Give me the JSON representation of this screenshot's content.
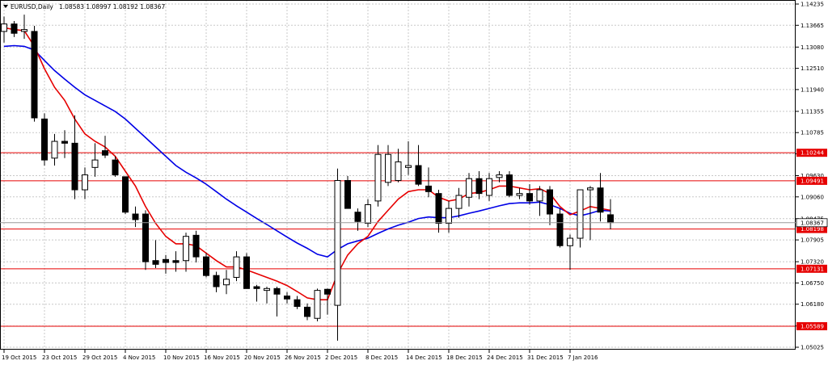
{
  "header": {
    "symbol_label": "EURUSD,Daily",
    "ohlc_label": "1.08583 1.08997 1.08192 1.08367"
  },
  "colors": {
    "background": "#ffffff",
    "grid": "#c8c8c8",
    "candle": "#000000",
    "ma_fast": "#e60000",
    "ma_slow": "#0000e6",
    "level_line": "#e60000",
    "level_box_bg": "#e60000",
    "level_box_text": "#ffffff"
  },
  "chart_data": {
    "type": "candlestick",
    "instrument": "EURUSD",
    "timeframe": "Daily",
    "ylim": [
      1.05025,
      1.14235
    ],
    "y_ticks": [
      "1.14235",
      "1.13665",
      "1.13080",
      "1.12510",
      "1.11940",
      "1.11355",
      "1.10785",
      "1.10215",
      "1.09630",
      "1.09060",
      "1.08475",
      "1.07905",
      "1.07320",
      "1.06750",
      "1.06180",
      "1.05595",
      "1.05025"
    ],
    "x_tick_labels": [
      "19 Oct 2015",
      "23 Oct 2015",
      "29 Oct 2015",
      "4 Nov 2015",
      "10 Nov 2015",
      "16 Nov 2015",
      "20 Nov 2015",
      "26 Nov 2015",
      "2 Dec 2015",
      "8 Dec 2015",
      "14 Dec 2015",
      "18 Dec 2015",
      "24 Dec 2015",
      "31 Dec 2015",
      "7 Jan 2016"
    ],
    "x_tick_bar_index": [
      0,
      4,
      8,
      12,
      16,
      20,
      24,
      28,
      32,
      36,
      40,
      44,
      48,
      52,
      56
    ],
    "grid": true,
    "candles": [
      {
        "o": 1.135,
        "h": 1.139,
        "l": 1.132,
        "c": 1.137
      },
      {
        "o": 1.137,
        "h": 1.1378,
        "l": 1.1335,
        "c": 1.1345
      },
      {
        "o": 1.135,
        "h": 1.1395,
        "l": 1.133,
        "c": 1.1355
      },
      {
        "o": 1.135,
        "h": 1.1365,
        "l": 1.1108,
        "c": 1.1118
      },
      {
        "o": 1.1115,
        "h": 1.113,
        "l": 1.099,
        "c": 1.1005
      },
      {
        "o": 1.101,
        "h": 1.1075,
        "l": 1.099,
        "c": 1.1055
      },
      {
        "o": 1.1055,
        "h": 1.1085,
        "l": 1.101,
        "c": 1.105
      },
      {
        "o": 1.105,
        "h": 1.1125,
        "l": 1.09,
        "c": 1.0925
      },
      {
        "o": 1.0925,
        "h": 1.0985,
        "l": 1.09,
        "c": 1.0965
      },
      {
        "o": 1.0985,
        "h": 1.105,
        "l": 1.096,
        "c": 1.1005
      },
      {
        "o": 1.103,
        "h": 1.107,
        "l": 1.101,
        "c": 1.1018
      },
      {
        "o": 1.1005,
        "h": 1.1015,
        "l": 1.096,
        "c": 1.0965
      },
      {
        "o": 1.096,
        "h": 1.096,
        "l": 1.086,
        "c": 1.0865
      },
      {
        "o": 1.086,
        "h": 1.088,
        "l": 1.0825,
        "c": 1.0845
      },
      {
        "o": 1.086,
        "h": 1.087,
        "l": 1.071,
        "c": 1.0732
      },
      {
        "o": 1.0735,
        "h": 1.079,
        "l": 1.0715,
        "c": 1.0725
      },
      {
        "o": 1.0738,
        "h": 1.075,
        "l": 1.07,
        "c": 1.073
      },
      {
        "o": 1.0735,
        "h": 1.076,
        "l": 1.0705,
        "c": 1.073
      },
      {
        "o": 1.0735,
        "h": 1.081,
        "l": 1.0705,
        "c": 1.08
      },
      {
        "o": 1.0803,
        "h": 1.0815,
        "l": 1.073,
        "c": 1.0745
      },
      {
        "o": 1.0745,
        "h": 1.0755,
        "l": 1.069,
        "c": 1.0695
      },
      {
        "o": 1.0695,
        "h": 1.0705,
        "l": 1.065,
        "c": 1.0665
      },
      {
        "o": 1.067,
        "h": 1.071,
        "l": 1.0645,
        "c": 1.0685
      },
      {
        "o": 1.069,
        "h": 1.076,
        "l": 1.068,
        "c": 1.0745
      },
      {
        "o": 1.0745,
        "h": 1.0755,
        "l": 1.066,
        "c": 1.066
      },
      {
        "o": 1.0665,
        "h": 1.067,
        "l": 1.0625,
        "c": 1.066
      },
      {
        "o": 1.0655,
        "h": 1.0665,
        "l": 1.062,
        "c": 1.066
      },
      {
        "o": 1.066,
        "h": 1.0665,
        "l": 1.0585,
        "c": 1.0645
      },
      {
        "o": 1.064,
        "h": 1.065,
        "l": 1.062,
        "c": 1.0632
      },
      {
        "o": 1.063,
        "h": 1.064,
        "l": 1.0605,
        "c": 1.0612
      },
      {
        "o": 1.061,
        "h": 1.062,
        "l": 1.0575,
        "c": 1.0585
      },
      {
        "o": 1.058,
        "h": 1.066,
        "l": 1.0572,
        "c": 1.0655
      },
      {
        "o": 1.0658,
        "h": 1.066,
        "l": 1.059,
        "c": 1.0645
      },
      {
        "o": 1.0615,
        "h": 1.0982,
        "l": 1.052,
        "c": 1.095
      },
      {
        "o": 1.095,
        "h": 1.0962,
        "l": 1.0875,
        "c": 1.0875
      },
      {
        "o": 1.0865,
        "h": 1.0875,
        "l": 1.0815,
        "c": 1.084
      },
      {
        "o": 1.0835,
        "h": 1.09,
        "l": 1.0825,
        "c": 1.0885
      },
      {
        "o": 1.0895,
        "h": 1.1045,
        "l": 1.088,
        "c": 1.102
      },
      {
        "o": 1.0945,
        "h": 1.1045,
        "l": 1.0935,
        "c": 1.102
      },
      {
        "o": 1.095,
        "h": 1.1035,
        "l": 1.0945,
        "c": 1.1
      },
      {
        "o": 1.0985,
        "h": 1.1055,
        "l": 1.0965,
        "c": 1.099
      },
      {
        "o": 1.099,
        "h": 1.1045,
        "l": 1.0935,
        "c": 1.094
      },
      {
        "o": 1.0935,
        "h": 1.0985,
        "l": 1.0905,
        "c": 1.092
      },
      {
        "o": 1.0915,
        "h": 1.0925,
        "l": 1.081,
        "c": 1.0835
      },
      {
        "o": 1.0835,
        "h": 1.0895,
        "l": 1.081,
        "c": 1.0875
      },
      {
        "o": 1.0875,
        "h": 1.093,
        "l": 1.085,
        "c": 1.091
      },
      {
        "o": 1.0905,
        "h": 1.097,
        "l": 1.088,
        "c": 1.0955
      },
      {
        "o": 1.0955,
        "h": 1.0975,
        "l": 1.09,
        "c": 1.0915
      },
      {
        "o": 1.091,
        "h": 1.097,
        "l": 1.0895,
        "c": 1.0955
      },
      {
        "o": 1.0958,
        "h": 1.0975,
        "l": 1.0945,
        "c": 1.0965
      },
      {
        "o": 1.0965,
        "h": 1.0975,
        "l": 1.0905,
        "c": 1.091
      },
      {
        "o": 1.091,
        "h": 1.093,
        "l": 1.09,
        "c": 1.0915
      },
      {
        "o": 1.0915,
        "h": 1.094,
        "l": 1.0885,
        "c": 1.0895
      },
      {
        "o": 1.0895,
        "h": 1.0935,
        "l": 1.0855,
        "c": 1.0925
      },
      {
        "o": 1.0925,
        "h": 1.0935,
        "l": 1.083,
        "c": 1.086
      },
      {
        "o": 1.086,
        "h": 1.0875,
        "l": 1.077,
        "c": 1.0775
      },
      {
        "o": 1.0775,
        "h": 1.0805,
        "l": 1.071,
        "c": 1.0795
      },
      {
        "o": 1.0795,
        "h": 1.086,
        "l": 1.077,
        "c": 1.0925
      },
      {
        "o": 1.0925,
        "h": 1.0935,
        "l": 1.079,
        "c": 1.093
      },
      {
        "o": 1.093,
        "h": 1.097,
        "l": 1.084,
        "c": 1.0865
      },
      {
        "o": 1.0858,
        "h": 1.09,
        "l": 1.0819,
        "c": 1.0837
      }
    ],
    "ma_fast": [
      1.136,
      1.1355,
      1.1352,
      1.131,
      1.125,
      1.12,
      1.1165,
      1.1115,
      1.1075,
      1.1055,
      1.104,
      1.1015,
      1.0975,
      1.0935,
      1.088,
      1.0835,
      1.08,
      1.078,
      1.078,
      1.0775,
      1.0755,
      1.0735,
      1.0718,
      1.0718,
      1.071,
      1.07,
      1.069,
      1.068,
      1.0668,
      1.0652,
      1.0635,
      1.063,
      1.063,
      1.07,
      1.075,
      1.078,
      1.08,
      1.084,
      1.087,
      1.09,
      1.092,
      1.0925,
      1.0925,
      1.0905,
      1.0895,
      1.09,
      1.0915,
      1.0918,
      1.0925,
      1.0935,
      1.0935,
      1.093,
      1.0925,
      1.0928,
      1.0915,
      1.088,
      1.0858,
      1.0868,
      1.088,
      1.0875,
      1.087
    ],
    "ma_slow": [
      1.131,
      1.1312,
      1.131,
      1.13,
      1.1272,
      1.1245,
      1.1222,
      1.12,
      1.118,
      1.1165,
      1.115,
      1.1135,
      1.1115,
      1.109,
      1.1065,
      1.104,
      1.1015,
      1.099,
      1.0972,
      1.0957,
      1.094,
      1.092,
      1.09,
      1.0882,
      1.0865,
      1.0848,
      1.0832,
      1.0815,
      1.0798,
      1.0782,
      1.0768,
      1.0752,
      1.0745,
      1.0765,
      1.078,
      1.0788,
      1.0795,
      1.0808,
      1.082,
      1.083,
      1.0838,
      1.0848,
      1.0852,
      1.085,
      1.085,
      1.0855,
      1.0862,
      1.0868,
      1.0875,
      1.0882,
      1.0888,
      1.089,
      1.089,
      1.0892,
      1.0885,
      1.0875,
      1.0862,
      1.0855,
      1.0862,
      1.087,
      1.0868
    ],
    "levels": [
      {
        "value": 1.10244,
        "label": "1.10244"
      },
      {
        "value": 1.09491,
        "label": "1.09491"
      },
      {
        "value": 1.08198,
        "label": "1.08198"
      },
      {
        "value": 1.07131,
        "label": "1.07131"
      },
      {
        "value": 1.05589,
        "label": "1.05589"
      }
    ],
    "current_price": {
      "value": 1.08367,
      "label": "1.08367"
    }
  }
}
